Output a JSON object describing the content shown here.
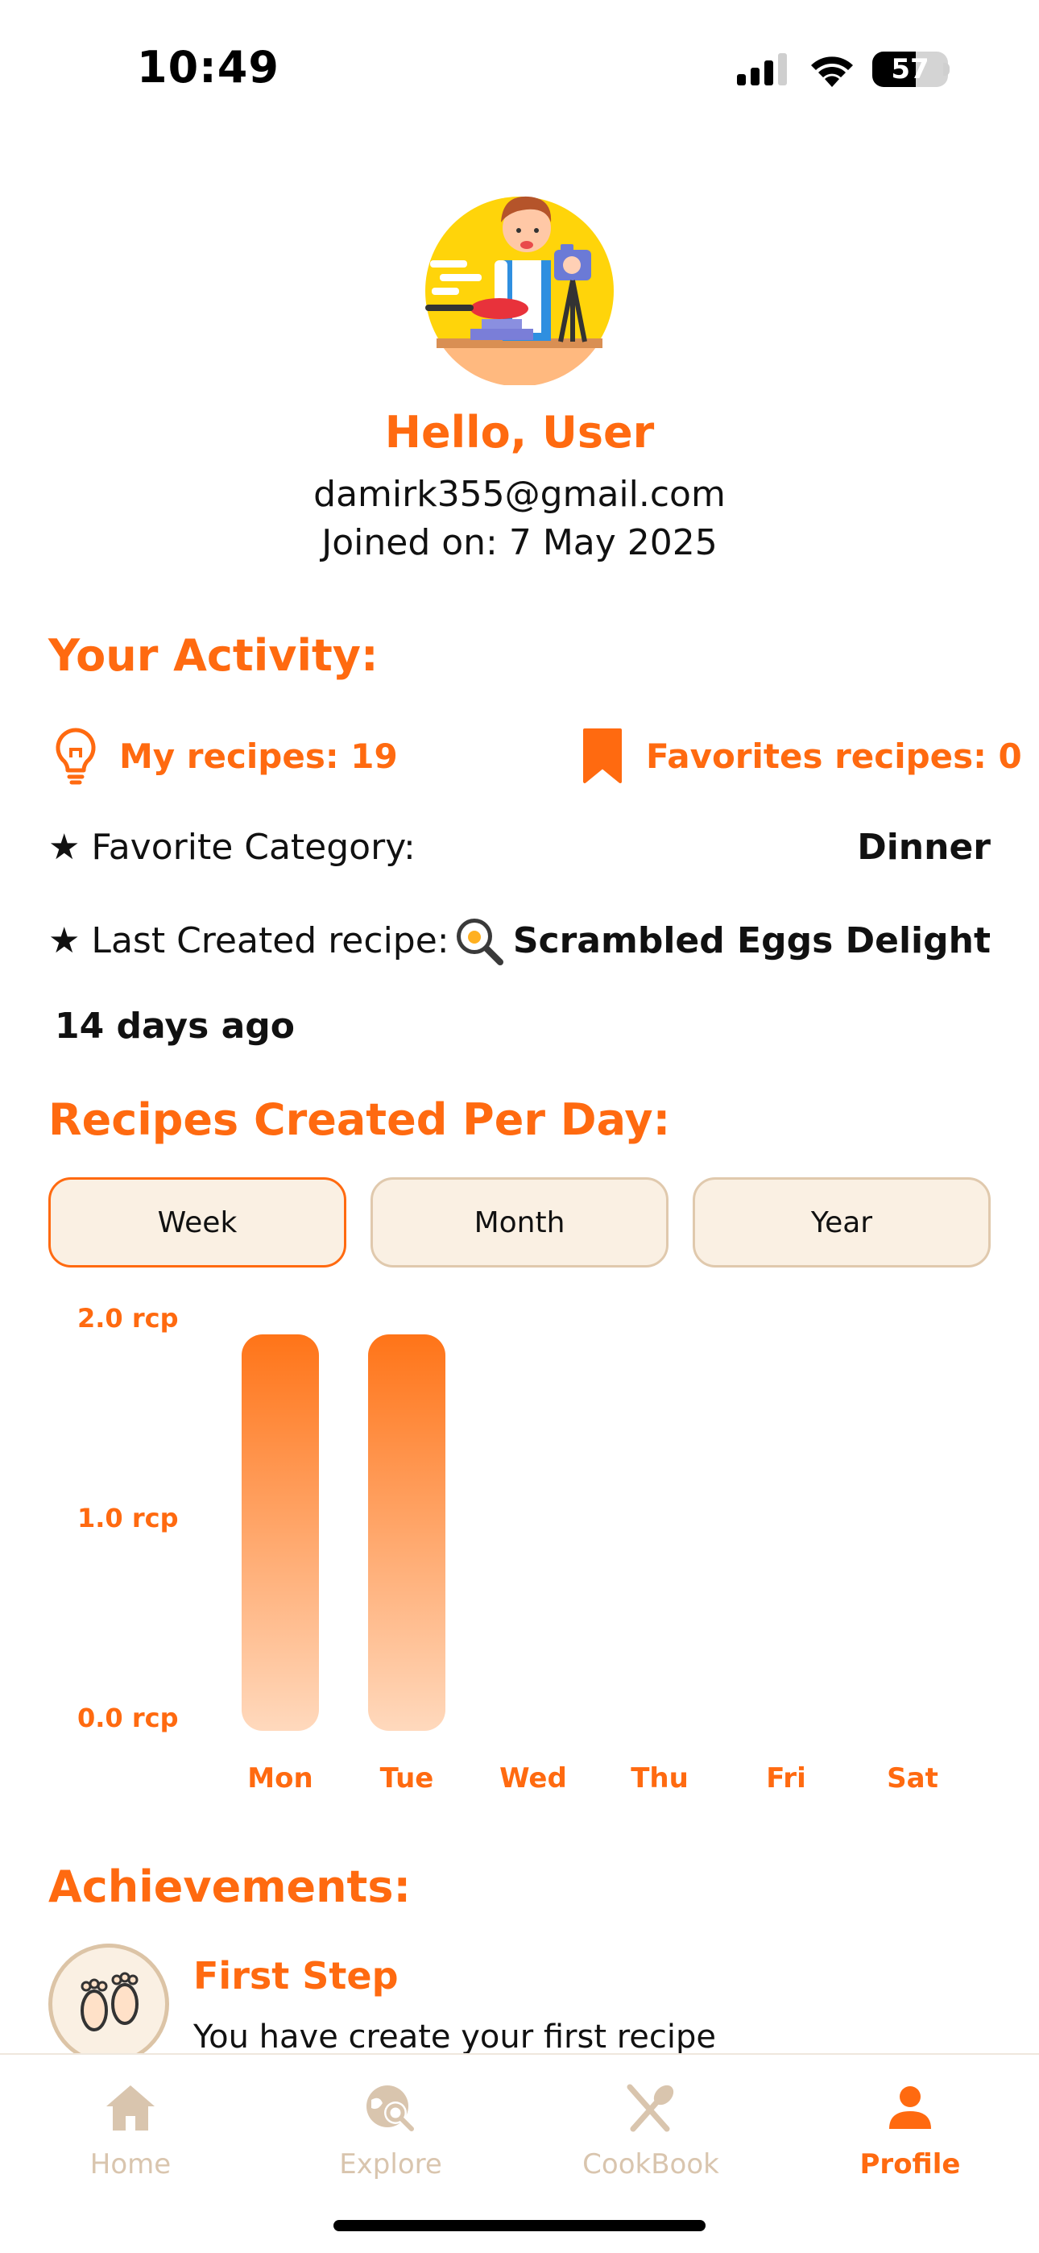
{
  "status_bar": {
    "time": "10:49",
    "battery": "57",
    "battery_level": 0.57
  },
  "profile": {
    "greeting": "Hello, User",
    "email": "damirk355@gmail.com",
    "joined": "Joined on: 7 May 2025"
  },
  "activity": {
    "title": "Your Activity:",
    "my_recipes": "My recipes: 19",
    "favorites": "Favorites recipes: 0",
    "favorite_category_label": "★ Favorite Category:",
    "favorite_category_value": "Dinner",
    "last_created_label": "★ Last Created recipe:",
    "last_created_value": "Scrambled Eggs Delight",
    "last_created_ago": "14 days ago"
  },
  "chart_section": {
    "title": "Recipes Created Per Day:",
    "tabs": [
      "Week",
      "Month",
      "Year"
    ],
    "active_tab": "Week"
  },
  "chart_data": {
    "type": "bar",
    "categories": [
      "Mon",
      "Tue",
      "Wed",
      "Thu",
      "Fri",
      "Sat"
    ],
    "values": [
      2,
      2,
      0,
      0,
      0,
      0
    ],
    "ylim": [
      0,
      2
    ],
    "y_ticks": [
      "2.0 rcp",
      "1.0 rcp",
      "0.0 rcp"
    ],
    "bar_color_top": "#ff7418",
    "bar_color_bottom": "#ffd9bd"
  },
  "achievements": {
    "title": "Achievements:",
    "items": [
      {
        "title": "First Step",
        "description": "You have create your first recipe"
      }
    ]
  },
  "tabbar": {
    "items": [
      {
        "label": "Home",
        "icon": "home-icon"
      },
      {
        "label": "Explore",
        "icon": "explore-icon"
      },
      {
        "label": "CookBook",
        "icon": "cookbook-icon"
      },
      {
        "label": "Profile",
        "icon": "profile-icon"
      }
    ],
    "active": "Profile"
  },
  "colors": {
    "accent": "#ff6a10",
    "tab_inactive": "#d9c5ae",
    "chip_bg": "#faf0e3"
  }
}
